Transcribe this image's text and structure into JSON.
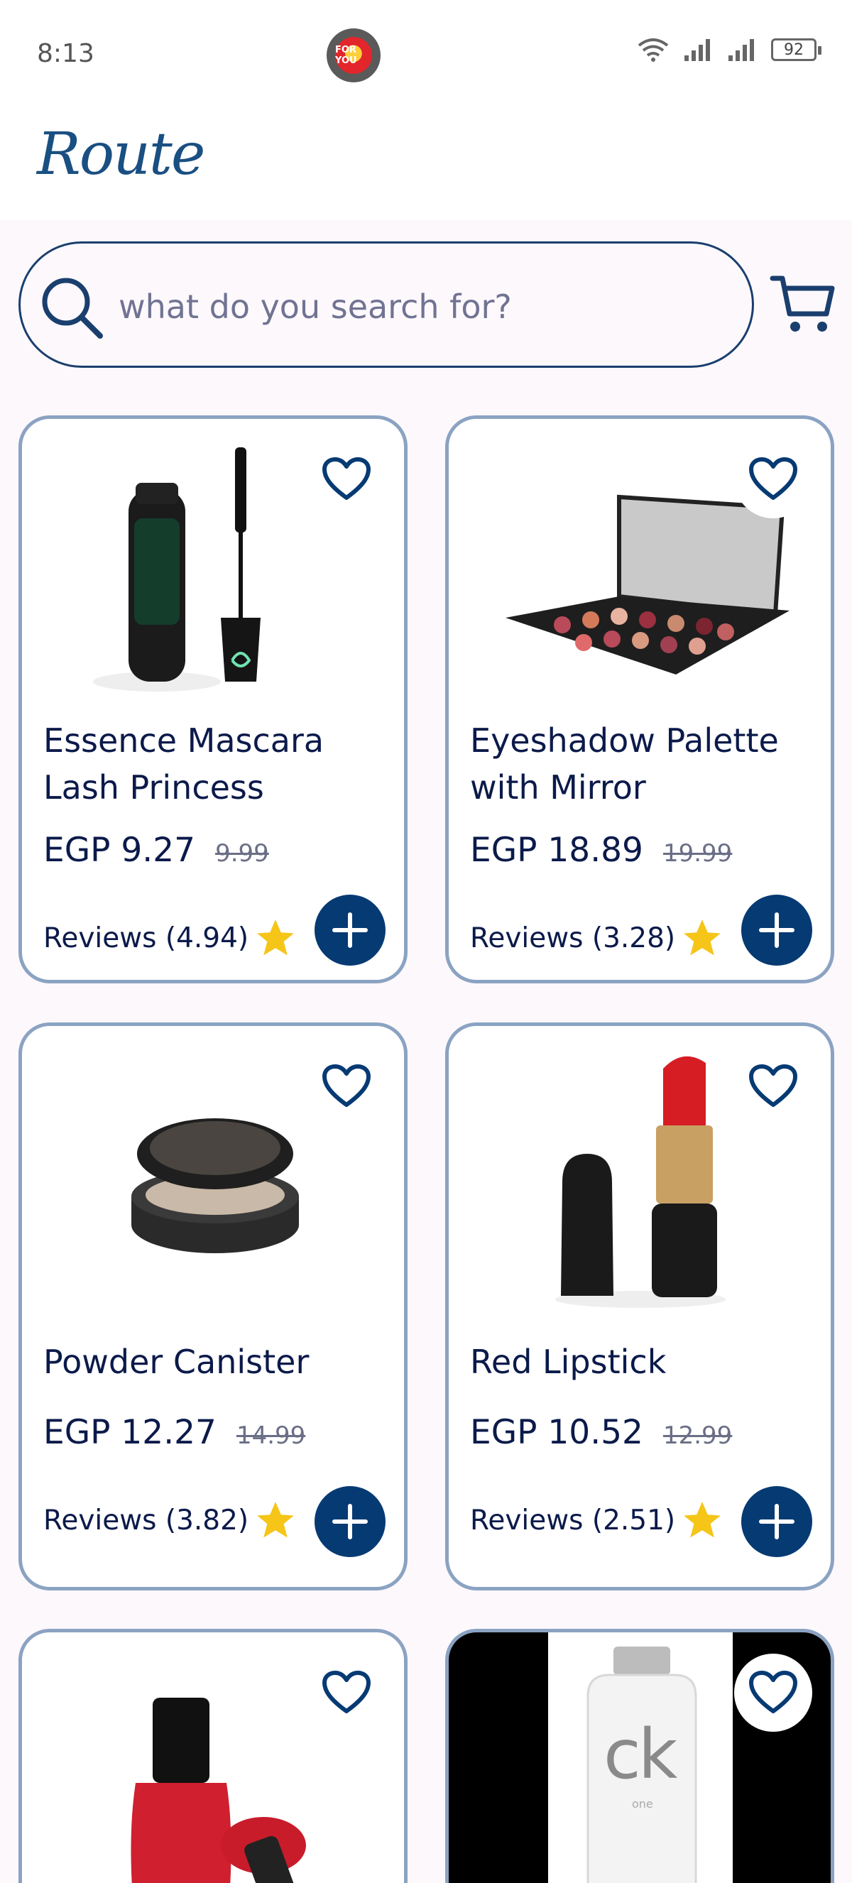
{
  "status_bar": {
    "time": "8:13",
    "battery": "92",
    "notification_badge": "FOR YOU"
  },
  "header": {
    "logo": "Route"
  },
  "search": {
    "placeholder": "what do you search for?"
  },
  "colors": {
    "primary": "#063a73",
    "card_border": "#8ba3c2",
    "text": "#0b1a4a",
    "star": "#f5c518"
  },
  "products": [
    {
      "title": "Essence Mascara Lash Princess",
      "price": "EGP 9.27",
      "old_price": "9.99",
      "reviews": "Reviews (4.94)",
      "image_icon": "mascara-image"
    },
    {
      "title": "Eyeshadow Palette with Mirror",
      "price": "EGP 18.89",
      "old_price": "19.99",
      "reviews": "Reviews (3.28)",
      "image_icon": "eyeshadow-palette-image"
    },
    {
      "title": "Powder Canister",
      "price": "EGP 12.27",
      "old_price": "14.99",
      "reviews": "Reviews (3.82)",
      "image_icon": "powder-canister-image"
    },
    {
      "title": "Red Lipstick",
      "price": "EGP 10.52",
      "old_price": "12.99",
      "reviews": "Reviews (2.51)",
      "image_icon": "lipstick-image"
    },
    {
      "image_icon": "nail-polish-image"
    },
    {
      "image_icon": "ck-perfume-image",
      "image_text": "ck",
      "image_subtext": "one"
    }
  ]
}
